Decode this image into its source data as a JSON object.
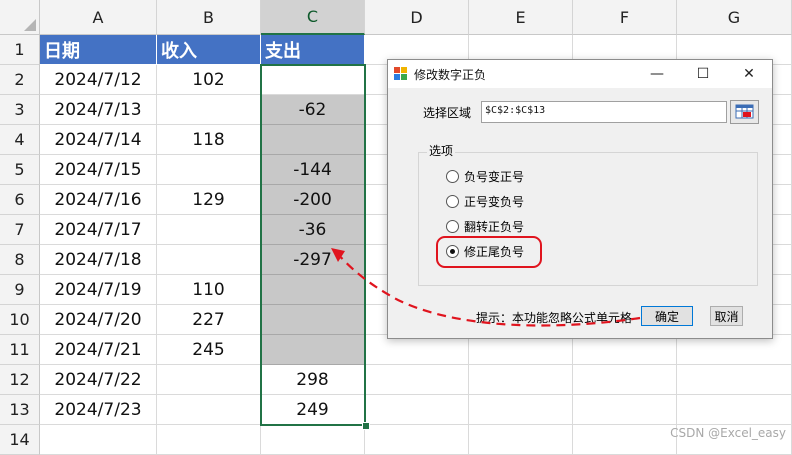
{
  "columns": [
    "A",
    "B",
    "C",
    "D",
    "E",
    "F",
    "G"
  ],
  "rows": [
    "1",
    "2",
    "3",
    "4",
    "5",
    "6",
    "7",
    "8",
    "9",
    "10",
    "11",
    "12",
    "13",
    "14"
  ],
  "header": {
    "date": "日期",
    "income": "收入",
    "expense": "支出"
  },
  "table": [
    {
      "date": "2024/7/12",
      "income": "102",
      "expense": ""
    },
    {
      "date": "2024/7/13",
      "income": "",
      "expense": "-62"
    },
    {
      "date": "2024/7/14",
      "income": "118",
      "expense": ""
    },
    {
      "date": "2024/7/15",
      "income": "",
      "expense": "-144"
    },
    {
      "date": "2024/7/16",
      "income": "129",
      "expense": "-200"
    },
    {
      "date": "2024/7/17",
      "income": "",
      "expense": "-36"
    },
    {
      "date": "2024/7/18",
      "income": "",
      "expense": "-297"
    },
    {
      "date": "2024/7/19",
      "income": "110",
      "expense": ""
    },
    {
      "date": "2024/7/20",
      "income": "227",
      "expense": ""
    },
    {
      "date": "2024/7/21",
      "income": "245",
      "expense": ""
    },
    {
      "date": "2024/7/22",
      "income": "",
      "expense": "298"
    },
    {
      "date": "2024/7/23",
      "income": "",
      "expense": "249"
    }
  ],
  "dialog": {
    "title": "修改数字正负",
    "minimize": "—",
    "maximize": "☐",
    "close": "✕",
    "range_label": "选择区域",
    "range_value": "$C$2:$C$13",
    "options_label": "选项",
    "options": [
      "负号变正号",
      "正号变负号",
      "翻转正负号",
      "修正尾负号"
    ],
    "selected_option": 3,
    "hint": "提示：本功能忽略公式单元格",
    "ok": "确定",
    "cancel": "取消"
  },
  "watermark": "CSDN @Excel_easy",
  "colors": {
    "header_fill": "#4472c4",
    "selected_fill": "#c8c8c8",
    "selection": "#217346",
    "annotation": "#e0141e"
  }
}
